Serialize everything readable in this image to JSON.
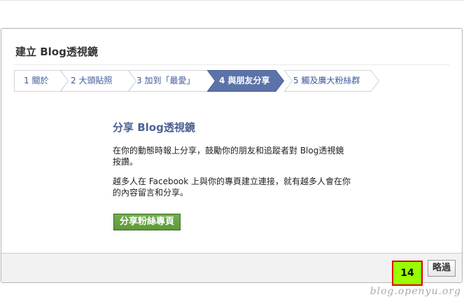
{
  "dialog": {
    "title": "建立 Blog透視鏡"
  },
  "steps": [
    {
      "label": "1 關於",
      "active": false
    },
    {
      "label": "2 大頭貼照",
      "active": false
    },
    {
      "label": "3 加到「最愛」",
      "active": false
    },
    {
      "label": "4 與朋友分享",
      "active": true
    },
    {
      "label": "5 觸及廣大粉絲群",
      "active": false
    }
  ],
  "content": {
    "heading": "分享 Blog透視鏡",
    "paragraph_1": "在你的動態時報上分享，鼓勵你的朋友和追蹤者對 Blog透視鏡按讚。",
    "paragraph_2": "越多人在 Facebook 上與你的專頁建立連接，就有越多人會在你的內容留言和分享。",
    "share_button_label": "分享粉絲專頁"
  },
  "footer": {
    "skip_label": "略過"
  },
  "annotation": {
    "step_number": "14"
  },
  "watermark": "blog.openyu.org",
  "colors": {
    "active_step": "#5b73a8",
    "step_text": "#3b5998",
    "heading": "#4d6192",
    "share_button": "#69a043",
    "marker_fill": "#99ff00",
    "marker_border": "#e00000"
  }
}
